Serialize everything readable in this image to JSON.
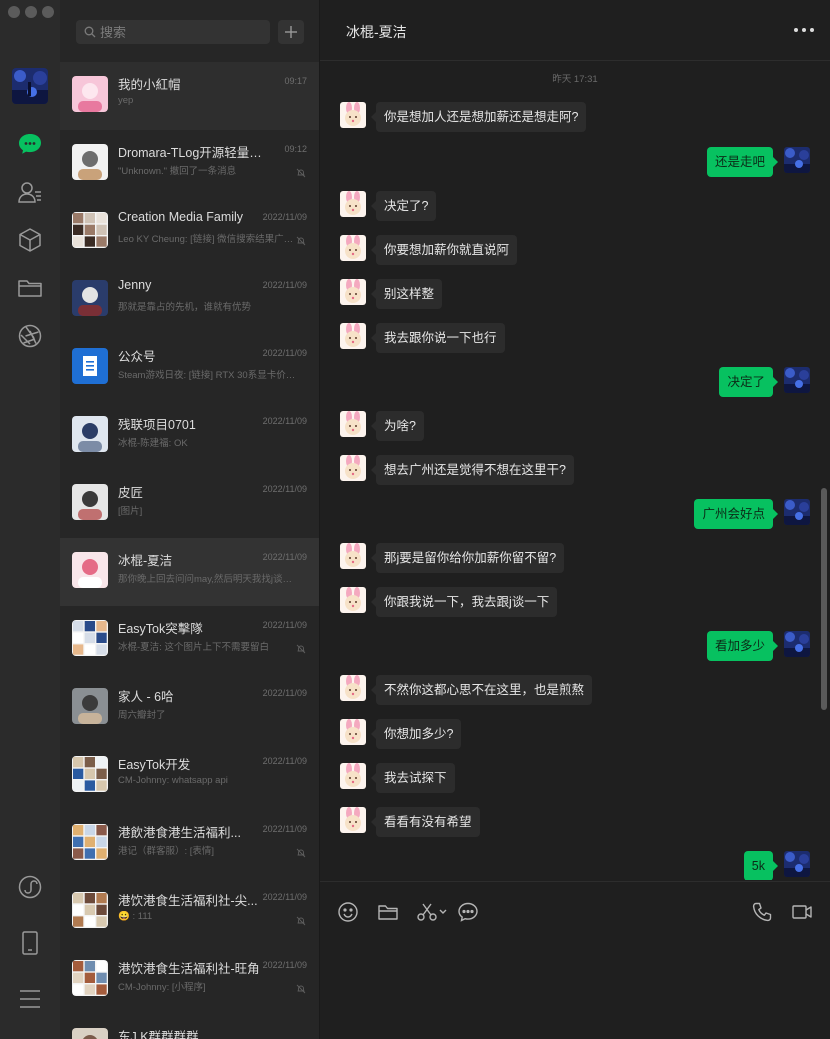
{
  "colors": {
    "accent_green": "#07c160",
    "rail_bg": "#2b2b2b",
    "list_bg": "#262626",
    "chat_bg": "#1f1f1f"
  },
  "search": {
    "placeholder": "搜索"
  },
  "rail": {
    "icons": [
      "chat-icon",
      "contacts-icon",
      "favorites-cube-icon",
      "files-folder-icon",
      "moments-aperture-icon",
      "miniprogram-icon",
      "phone-device-icon",
      "menu-icon"
    ]
  },
  "conversations": [
    {
      "name": "我的小紅帽",
      "time": "09:17",
      "preview": "yep",
      "muted": false
    },
    {
      "name": "Dromara-TLog开源轻量级日志...",
      "time": "09:12",
      "preview": "\"Unknown.\" 撤回了一条消息",
      "muted": true
    },
    {
      "name": "Creation Media Family",
      "time": "2022/11/09",
      "preview": "Leo KY Cheung: [链接] 微信搜索结果广告...",
      "muted": true
    },
    {
      "name": "Jenny",
      "time": "2022/11/09",
      "preview": "那就是靠占的先机，谁就有优势",
      "muted": false
    },
    {
      "name": "公众号",
      "time": "2022/11/09",
      "preview": "Steam游戏日夜: [链接] RTX 30系显卡价格...",
      "muted": false
    },
    {
      "name": "残联项目0701",
      "time": "2022/11/09",
      "preview": "冰棍-陈建福: OK",
      "muted": false
    },
    {
      "name": "皮匠",
      "time": "2022/11/09",
      "preview": "[图片]",
      "muted": false
    },
    {
      "name": "冰棍-夏洁",
      "time": "2022/11/09",
      "preview": "那你晚上回去问问may,然后明天我找j谈一下",
      "muted": false
    },
    {
      "name": "EasyTok突擊隊",
      "time": "2022/11/09",
      "preview": "冰棍-夏洁: 这个图片上下不需要留白",
      "muted": true
    },
    {
      "name": "家人 - 6哈",
      "time": "2022/11/09",
      "preview": "周六瓣封了",
      "muted": false
    },
    {
      "name": "EasyTok开发",
      "time": "2022/11/09",
      "preview": "CM-Johnny: whatsapp api",
      "muted": false
    },
    {
      "name": "港飲港食港生活福利...",
      "time": "2022/11/09",
      "preview": "港记（群客服）: [表情]",
      "muted": true
    },
    {
      "name": "港饮港食生活福利社-尖...",
      "time": "2022/11/09",
      "preview": "😀 : 111",
      "muted": true
    },
    {
      "name": "港饮港食生活福利社-旺角",
      "time": "2022/11/09",
      "preview": "CM-Johnny: [小程序]",
      "muted": true
    },
    {
      "name": "东J.K群群群群",
      "time": "",
      "preview": "",
      "muted": false
    }
  ],
  "chat": {
    "title": "冰棍-夏洁",
    "timestamp": "昨天 17:31",
    "messages": [
      {
        "dir": "in",
        "text": "你是想加人还是想加薪还是想走阿?"
      },
      {
        "dir": "out",
        "text": "还是走吧"
      },
      {
        "dir": "in",
        "text": "决定了?"
      },
      {
        "dir": "in",
        "text": "你要想加薪你就直说阿"
      },
      {
        "dir": "in",
        "text": "别这样整"
      },
      {
        "dir": "in",
        "text": "我去跟你说一下也行"
      },
      {
        "dir": "out",
        "text": "决定了"
      },
      {
        "dir": "in",
        "text": "为啥?"
      },
      {
        "dir": "in",
        "text": "想去广州还是觉得不想在这里干?"
      },
      {
        "dir": "out",
        "text": "广州会好点"
      },
      {
        "dir": "in",
        "text": "那j要是留你给你加薪你留不留?"
      },
      {
        "dir": "in",
        "text": "你跟我说一下，我去跟j谈一下"
      },
      {
        "dir": "out",
        "text": "看加多少"
      },
      {
        "dir": "in",
        "text": "不然你这都心思不在这里，也是煎熬"
      },
      {
        "dir": "in",
        "text": "你想加多少?"
      },
      {
        "dir": "in",
        "text": "我去试探下"
      },
      {
        "dir": "in",
        "text": "看看有没有希望"
      },
      {
        "dir": "out",
        "text": "5k"
      }
    ]
  },
  "composer": {
    "tools_left": [
      "emoji-icon",
      "folder-icon",
      "scissors-screenshot-icon",
      "chat-history-icon"
    ],
    "tools_right": [
      "voice-call-icon",
      "video-call-icon"
    ]
  }
}
